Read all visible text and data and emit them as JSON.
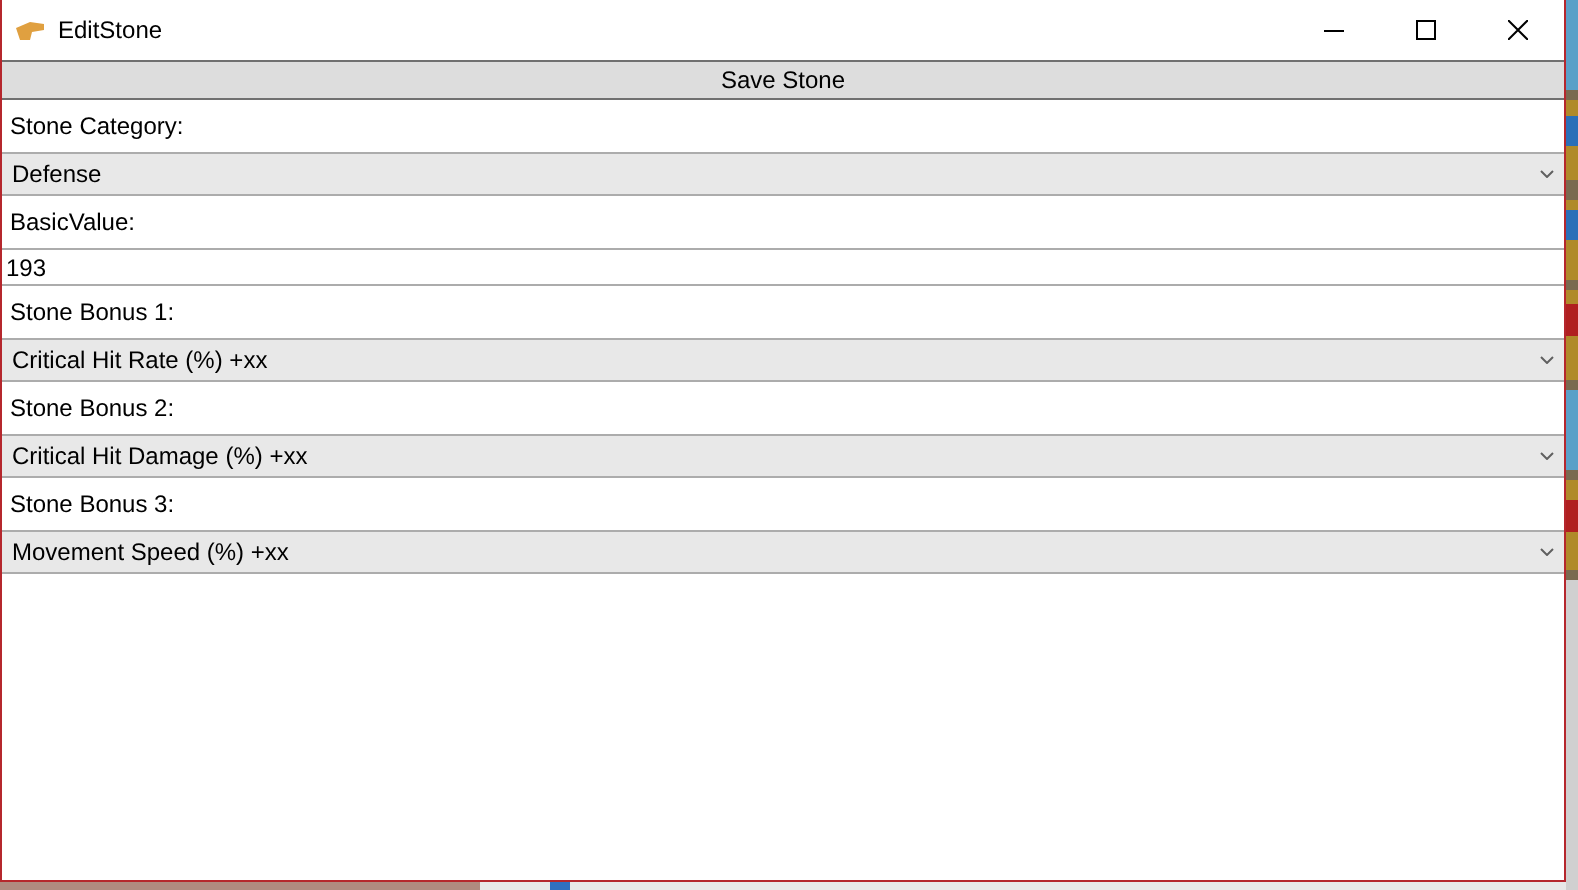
{
  "window": {
    "title": "EditStone"
  },
  "save_button": "Save Stone",
  "fields": [
    {
      "label": "Stone Category:",
      "kind": "dropdown",
      "value": "Defense"
    },
    {
      "label": "BasicValue:",
      "kind": "text",
      "value": "193"
    },
    {
      "label": "Stone Bonus 1:",
      "kind": "dropdown",
      "value": "Critical Hit Rate (%) +xx"
    },
    {
      "label": "Stone Bonus 2:",
      "kind": "dropdown",
      "value": "Critical Hit Damage (%) +xx"
    },
    {
      "label": "Stone Bonus 3:",
      "kind": "dropdown",
      "value": "Movement Speed (%) +xx"
    }
  ]
}
